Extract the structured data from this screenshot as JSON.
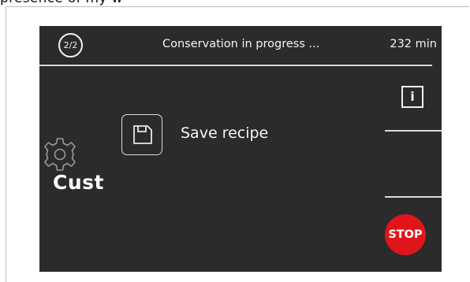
{
  "top_text": "presence of my w",
  "header": {
    "page_indicator": "2/2",
    "status": "Conservation in progress ...",
    "remaining_time": "232 min"
  },
  "side": {
    "info_label": "i"
  },
  "main": {
    "save_label": "Save recipe",
    "cust_label": "Cust"
  },
  "stop": {
    "label": "STOP",
    "color": "#e0151a"
  },
  "colors": {
    "screen_bg": "#2b2b2b",
    "foreground": "#f2f2f2"
  }
}
